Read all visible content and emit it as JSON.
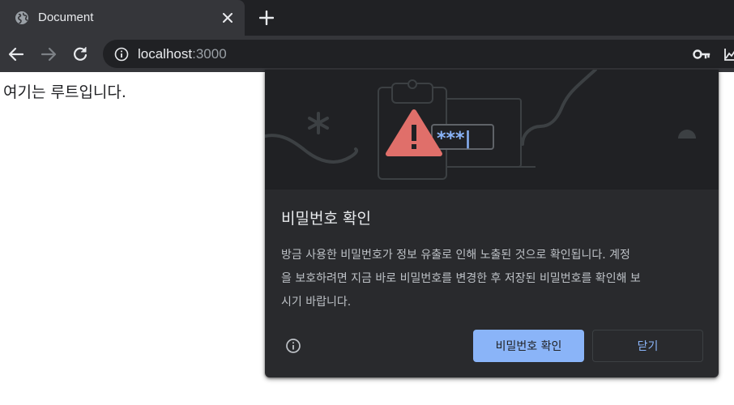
{
  "tab": {
    "title": "Document",
    "favicon": "globe-icon",
    "close_icon": "close-icon",
    "new_tab_icon": "plus-icon"
  },
  "toolbar": {
    "back_icon": "arrow-left-icon",
    "forward_icon": "arrow-right-icon",
    "reload_icon": "reload-icon",
    "omnibox": {
      "security_icon": "info-icon",
      "host": "localhost",
      "port": ":3000",
      "key_icon": "key-icon"
    }
  },
  "page": {
    "text": "여기는 루트입니다."
  },
  "bubble": {
    "illustration_password_text": "***|",
    "title": "비밀번호 확인",
    "body_lines": [
      "방금 사용한 비밀번호가 정보 유출로 인해 노출된 것으로 확인됩니다. 계정",
      "을 보호하려면 지금 바로 비밀번호를 변경한 후 저장된 비밀번호를 확인해 보",
      "시기 바랍니다."
    ],
    "help_icon": "info-circle-icon",
    "primary_button": "비밀번호 확인",
    "secondary_button": "닫기"
  },
  "colors": {
    "tab_strip_bg": "#202124",
    "toolbar_bg": "#35363a",
    "omnibox_bg": "#202124",
    "bubble_bg": "#292a2d",
    "accent": "#8ab4f8",
    "warning_red": "#e06f6a"
  }
}
